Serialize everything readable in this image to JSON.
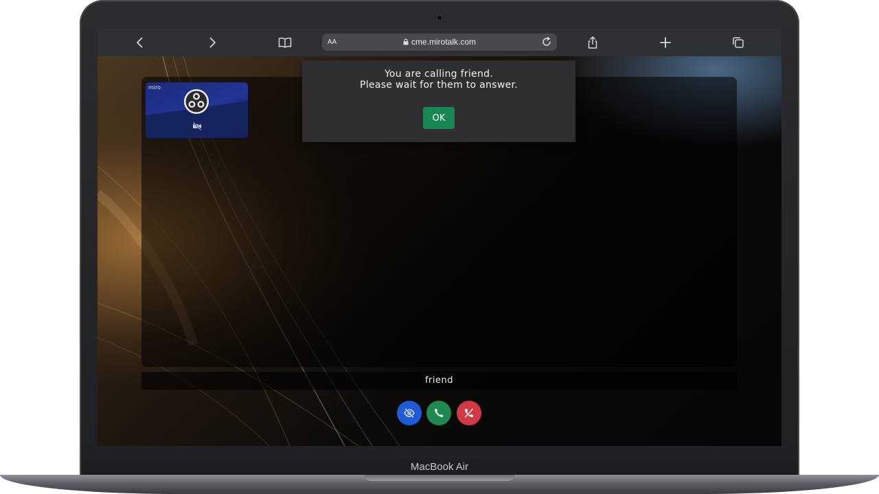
{
  "device": {
    "label": "MacBook Air"
  },
  "browser": {
    "url": "cme.mirotalk.com",
    "text_size_label": "AA",
    "icons": [
      "chevron-left-icon",
      "chevron-right-icon",
      "book-icon",
      "lock-icon",
      "reload-icon",
      "share-icon",
      "plus-icon",
      "tabs-icon"
    ]
  },
  "call": {
    "local_user_name": "miro",
    "remote_user_name": "friend",
    "dialog": {
      "line1": "You are calling friend.",
      "line2": "Please wait for them to answer.",
      "ok_label": "OK"
    },
    "buttons": [
      {
        "icon": "eye-slash-icon",
        "color": "#1f5bd6"
      },
      {
        "icon": "phone-icon",
        "color": "#1e8a4f"
      },
      {
        "icon": "phone-hangup-icon",
        "color": "#d13a44"
      }
    ]
  }
}
